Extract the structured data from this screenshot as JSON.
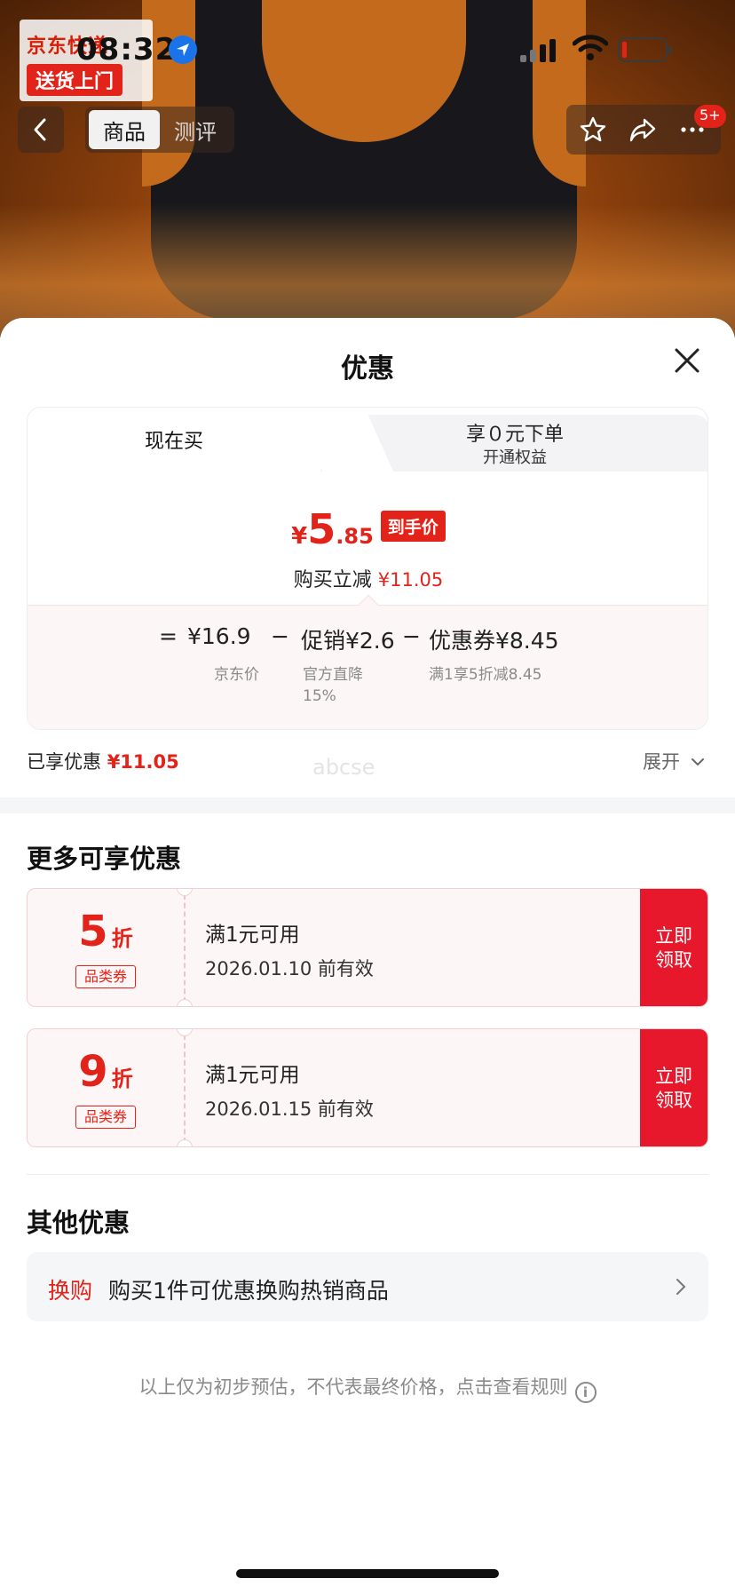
{
  "status_bar": {
    "time": "08:32"
  },
  "product_image": {
    "badge_line1": "京东快递",
    "badge_line2": "送货上门"
  },
  "nav": {
    "tabs": [
      {
        "label": "商品"
      },
      {
        "label": "测评"
      }
    ],
    "cart_badge": "5+"
  },
  "sheet": {
    "title": "优惠",
    "price_tabs": {
      "now_label": "现在买",
      "zero_title": "享０元下单",
      "zero_subtitle": "开通权益"
    },
    "final_price": {
      "currency": "¥",
      "integer": "5",
      "decimal": ".85",
      "tag": "到手价"
    },
    "reduce": {
      "label": "购买立减",
      "amount": "¥11.05"
    },
    "calc": {
      "equals": "=",
      "base_price": "¥16.9",
      "base_label": "京东价",
      "minus": "−",
      "promo": "促销¥2.6",
      "promo_label_line1": "官方直降",
      "promo_label_line2": "15%",
      "coupon": "优惠券¥8.45",
      "coupon_label": "满1享5折减8.45"
    },
    "enjoyed": {
      "label": "已享优惠",
      "amount": "¥11.05"
    },
    "expand_label": "展开",
    "watermark": "abcse"
  },
  "more_offers": {
    "title": "更多可享优惠",
    "coupons": [
      {
        "discount": "5",
        "unit": "折",
        "kind": "品类券",
        "condition": "满1元可用",
        "valid": "2026.01.10 前有效",
        "claim_line1": "立即",
        "claim_line2": "领取"
      },
      {
        "discount": "9",
        "unit": "折",
        "kind": "品类券",
        "condition": "满1元可用",
        "valid": "2026.01.15 前有效",
        "claim_line1": "立即",
        "claim_line2": "领取"
      }
    ]
  },
  "other_offers": {
    "title": "其他优惠",
    "swap_tag": "换购",
    "swap_text": "购买1件可优惠换购热销商品"
  },
  "disclaimer": "以上仅为初步预估，不代表最终价格，点击查看规则",
  "colors": {
    "accent_red": "#e2231a",
    "claim_red": "#e8182c"
  }
}
